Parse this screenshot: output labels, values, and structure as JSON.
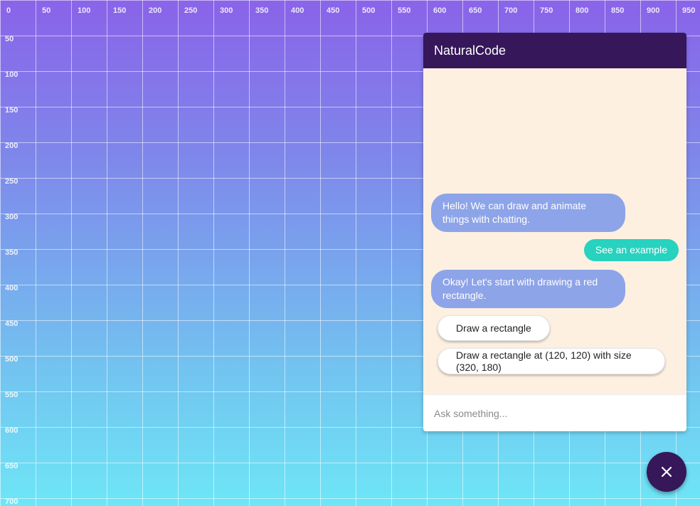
{
  "canvas": {
    "x_tick_labels": [
      "0",
      "50",
      "100",
      "150",
      "200",
      "250",
      "300",
      "350",
      "400",
      "450",
      "500",
      "550",
      "600",
      "650",
      "700",
      "750",
      "800",
      "850",
      "900",
      "950"
    ],
    "y_tick_labels": [
      "50",
      "100",
      "150",
      "200",
      "250",
      "300",
      "350",
      "400",
      "450",
      "500",
      "550",
      "600",
      "650",
      "700"
    ],
    "grid_color": "#ffffff"
  },
  "chat": {
    "title": "NaturalCode",
    "header_color": "#35175a",
    "background_color": "#fdf0e1",
    "messages": [
      {
        "from": "bot",
        "text": "Hello! We can draw and animate things with chatting."
      },
      {
        "from": "user",
        "text": "See an example"
      },
      {
        "from": "bot",
        "text": "Okay! Let's start with drawing a red rectangle."
      }
    ],
    "options": [
      {
        "label": "Draw a rectangle"
      },
      {
        "label": "Draw a rectangle at (120, 120) with size (320, 180)"
      }
    ],
    "input": {
      "placeholder": "Ask something...",
      "value": ""
    },
    "colors": {
      "bot_bubble": "#8ea4e9",
      "user_bubble": "#27d2bf"
    }
  },
  "fab": {
    "icon": "close-icon"
  }
}
